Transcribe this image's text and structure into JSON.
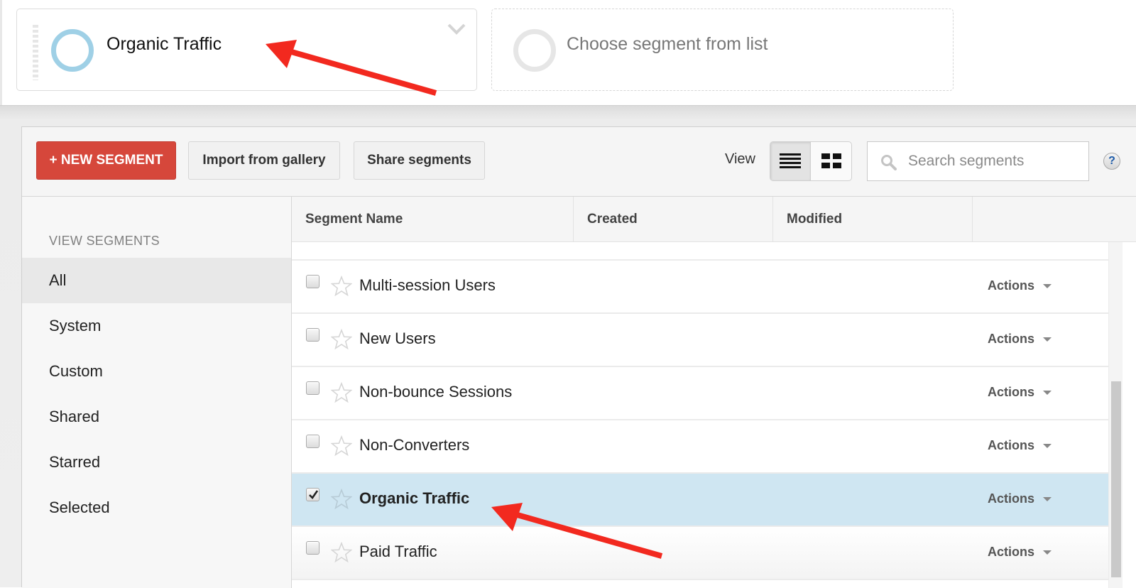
{
  "segment_picker": {
    "active_segment": {
      "label": "Organic Traffic",
      "ring_color": "#9fd0e6"
    },
    "empty_slot": {
      "label": "Choose segment from list"
    }
  },
  "toolbar": {
    "new_segment_label": "+ NEW SEGMENT",
    "import_label": "Import from gallery",
    "share_label": "Share segments",
    "view_label": "View",
    "view_modes": [
      {
        "name": "list",
        "icon": "list-view-icon",
        "active": true
      },
      {
        "name": "grid",
        "icon": "grid-view-icon",
        "active": false
      }
    ],
    "search_placeholder": "Search segments",
    "help_label": "?"
  },
  "sidebar": {
    "heading": "VIEW SEGMENTS",
    "items": [
      {
        "label": "All",
        "active": true
      },
      {
        "label": "System",
        "active": false
      },
      {
        "label": "Custom",
        "active": false
      },
      {
        "label": "Shared",
        "active": false
      },
      {
        "label": "Starred",
        "active": false
      },
      {
        "label": "Selected",
        "active": false
      }
    ]
  },
  "table": {
    "columns": [
      "Segment Name",
      "Created",
      "Modified",
      ""
    ],
    "rows": [
      {
        "name": "Multi-session Users",
        "checked": false,
        "starred": false,
        "created": "",
        "modified": "",
        "actions_label": "Actions"
      },
      {
        "name": "New Users",
        "checked": false,
        "starred": false,
        "created": "",
        "modified": "",
        "actions_label": "Actions"
      },
      {
        "name": "Non-bounce Sessions",
        "checked": false,
        "starred": false,
        "created": "",
        "modified": "",
        "actions_label": "Actions"
      },
      {
        "name": "Non-Converters",
        "checked": false,
        "starred": false,
        "created": "",
        "modified": "",
        "actions_label": "Actions"
      },
      {
        "name": "Organic Traffic",
        "checked": true,
        "starred": false,
        "created": "",
        "modified": "",
        "actions_label": "Actions"
      },
      {
        "name": "Paid Traffic",
        "checked": false,
        "starred": false,
        "created": "",
        "modified": "",
        "actions_label": "Actions"
      }
    ]
  },
  "colors": {
    "primary_button": "#d6473b",
    "selected_row": "#cfe6f2",
    "annotation_arrow": "#f2291f"
  }
}
